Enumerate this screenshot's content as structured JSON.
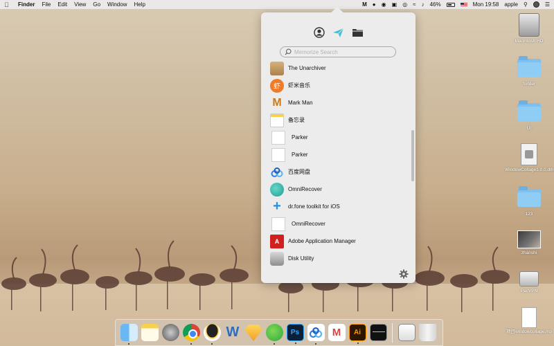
{
  "menubar": {
    "app_name": "Finder",
    "menus": [
      "File",
      "Edit",
      "View",
      "Go",
      "Window",
      "Help"
    ],
    "battery": "46%",
    "clock": "Mon 19:58",
    "user": "apple"
  },
  "desktop": {
    "items": [
      {
        "label": "Macintosh HD",
        "kind": "hd"
      },
      {
        "label": "forlder",
        "kind": "folder"
      },
      {
        "label": "UI",
        "kind": "folder"
      },
      {
        "label": "WindowCollage1.0.0.dmg",
        "kind": "dmg"
      },
      {
        "label": "123",
        "kind": "folder"
      },
      {
        "label": "zhanshi",
        "kind": "thumb"
      },
      {
        "label": "PacVPN",
        "kind": "external"
      },
      {
        "label": "项目windowcollage.mp",
        "kind": "doc"
      }
    ]
  },
  "popover": {
    "tabs": [
      {
        "icon": "person-icon",
        "active": false
      },
      {
        "icon": "paper-plane-icon",
        "active": true
      },
      {
        "icon": "folder-icon",
        "active": false
      }
    ],
    "search": {
      "placeholder": "Memorize Search",
      "value": ""
    },
    "apps": [
      {
        "name": "The Unarchiver",
        "icon": "unarchiver"
      },
      {
        "name": "虾米音乐",
        "icon": "xiami"
      },
      {
        "name": "Mark Man",
        "icon": "markman"
      },
      {
        "name": "备忘录",
        "icon": "notes"
      },
      {
        "name": "Parker",
        "icon": "doc"
      },
      {
        "name": "Parker",
        "icon": "doc"
      },
      {
        "name": "百度网盘",
        "icon": "baidu"
      },
      {
        "name": "OmniRecover",
        "icon": "omni"
      },
      {
        "name": "dr.fone toolkit for iOS",
        "icon": "drfone"
      },
      {
        "name": "OmniRecover",
        "icon": "doc"
      },
      {
        "name": "Adobe Application Manager",
        "icon": "adobe"
      },
      {
        "name": "Disk Utility",
        "icon": "disk"
      }
    ]
  },
  "dock": {
    "apps": [
      {
        "name": "finder",
        "cls": "d-finder",
        "glyph": "",
        "running": true
      },
      {
        "name": "notes",
        "cls": "d-notes",
        "glyph": "",
        "running": false
      },
      {
        "name": "launchpad",
        "cls": "d-launch",
        "glyph": "",
        "running": false
      },
      {
        "name": "chrome",
        "cls": "d-chrome",
        "glyph": "",
        "running": true
      },
      {
        "name": "qq",
        "cls": "d-qq",
        "glyph": "",
        "running": true
      },
      {
        "name": "word",
        "cls": "d-word",
        "glyph": "W",
        "running": false
      },
      {
        "name": "sketch",
        "cls": "d-sketch",
        "glyph": "",
        "running": false
      },
      {
        "name": "wechat",
        "cls": "d-wechat",
        "glyph": "",
        "running": true
      },
      {
        "name": "photoshop",
        "cls": "d-ps",
        "glyph": "Ps",
        "running": true
      },
      {
        "name": "baidu-netdisk",
        "cls": "d-baidu",
        "glyph": "",
        "running": true
      },
      {
        "name": "gmail",
        "cls": "d-gmail",
        "glyph": "M",
        "running": false
      },
      {
        "name": "illustrator",
        "cls": "d-ai",
        "glyph": "Ai",
        "running": true
      },
      {
        "name": "activity-monitor",
        "cls": "d-activity",
        "glyph": "",
        "running": false
      }
    ],
    "trailing": [
      {
        "name": "preview-stack",
        "cls": "d-preview",
        "glyph": ""
      },
      {
        "name": "trash",
        "cls": "d-trash",
        "glyph": ""
      }
    ]
  }
}
